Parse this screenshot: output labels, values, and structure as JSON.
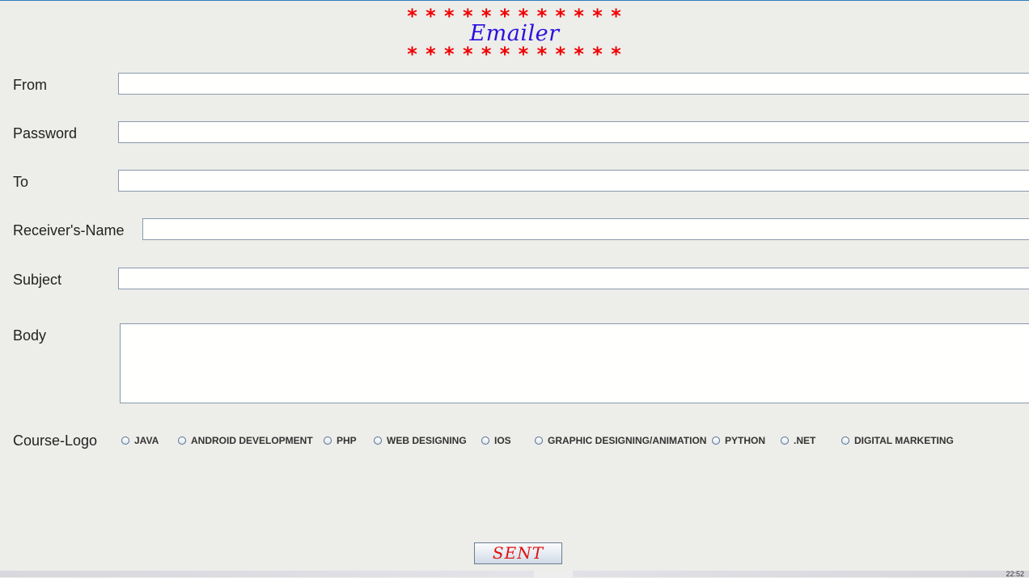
{
  "window": {
    "stars_line": "* * * * * * * * * * * *",
    "title": "Emailer"
  },
  "form": {
    "from_label": "From",
    "from_value": "",
    "password_label": "Password",
    "password_value": "",
    "to_label": "To",
    "to_value": "",
    "receiver_label": "Receiver's-Name",
    "receiver_value": "",
    "subject_label": "Subject",
    "subject_value": "",
    "body_label": "Body",
    "body_value": ""
  },
  "courses": {
    "label": "Course-Logo",
    "options": [
      "JAVA",
      "ANDROID DEVELOPMENT",
      "PHP",
      "WEB DESIGNING",
      "IOS",
      "GRAPHIC DESIGNING/ANIMATION",
      "PYTHON",
      ".NET",
      "DIGITAL MARKETING"
    ],
    "selected": null
  },
  "actions": {
    "send_label": "SENT"
  },
  "taskbar": {
    "clock": "22:52"
  },
  "colors": {
    "background": "#ededea",
    "stars": "#f00000",
    "title": "#2a10e0",
    "send_text": "#e01010"
  }
}
